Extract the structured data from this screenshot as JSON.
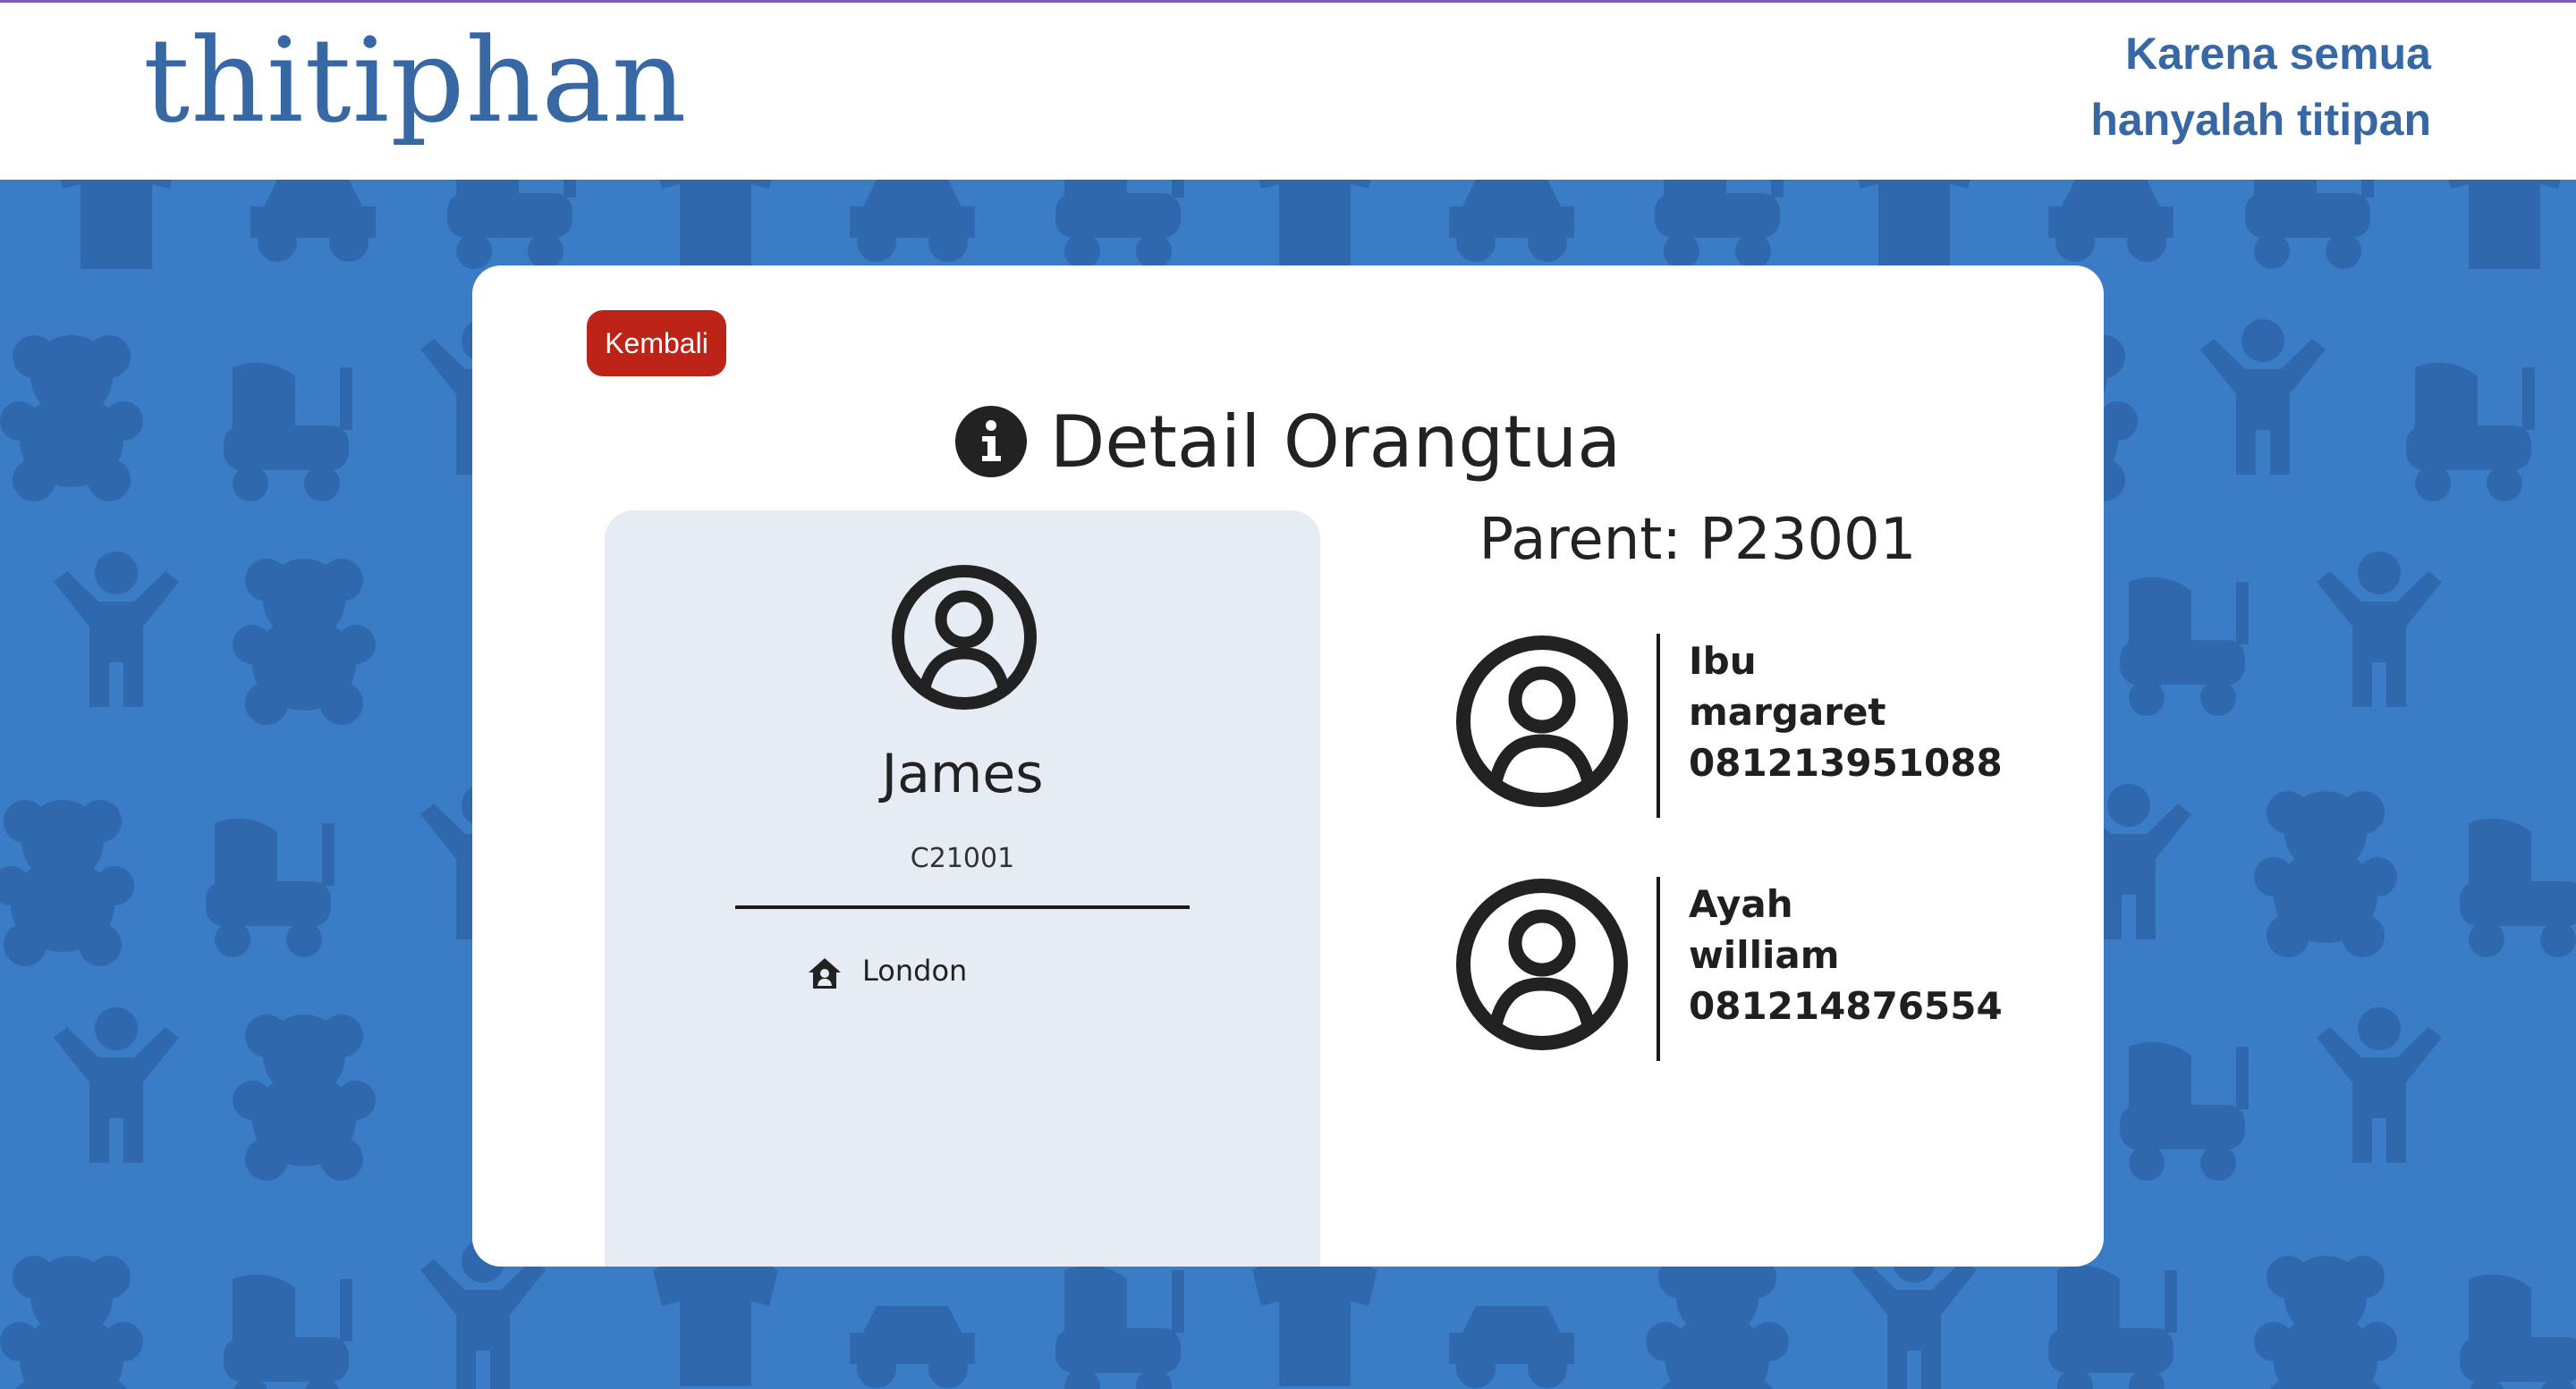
{
  "header": {
    "logo_text": "thitiphan",
    "tagline_line1": "Karena semua",
    "tagline_line2": "hanyalah titipan",
    "brand_color": "#3868a4",
    "background_color": "#3a7cc6"
  },
  "card": {
    "back_button_label": "Kembali",
    "title_icon": "info-icon",
    "title": "Detail Orangtua",
    "child": {
      "avatar_icon": "user-circle-icon",
      "name": "James",
      "code": "C21001",
      "address_icon": "house-user-icon",
      "address": "London"
    },
    "parent_label": "Parent: P23001",
    "guardians": [
      {
        "role": "Ibu",
        "name": "margaret",
        "phone": "081213951088",
        "avatar_icon": "user-circle-icon"
      },
      {
        "role": "Ayah",
        "name": "william",
        "phone": "081214876554",
        "avatar_icon": "user-circle-icon"
      }
    ],
    "back_button_color": "#bd2418"
  }
}
